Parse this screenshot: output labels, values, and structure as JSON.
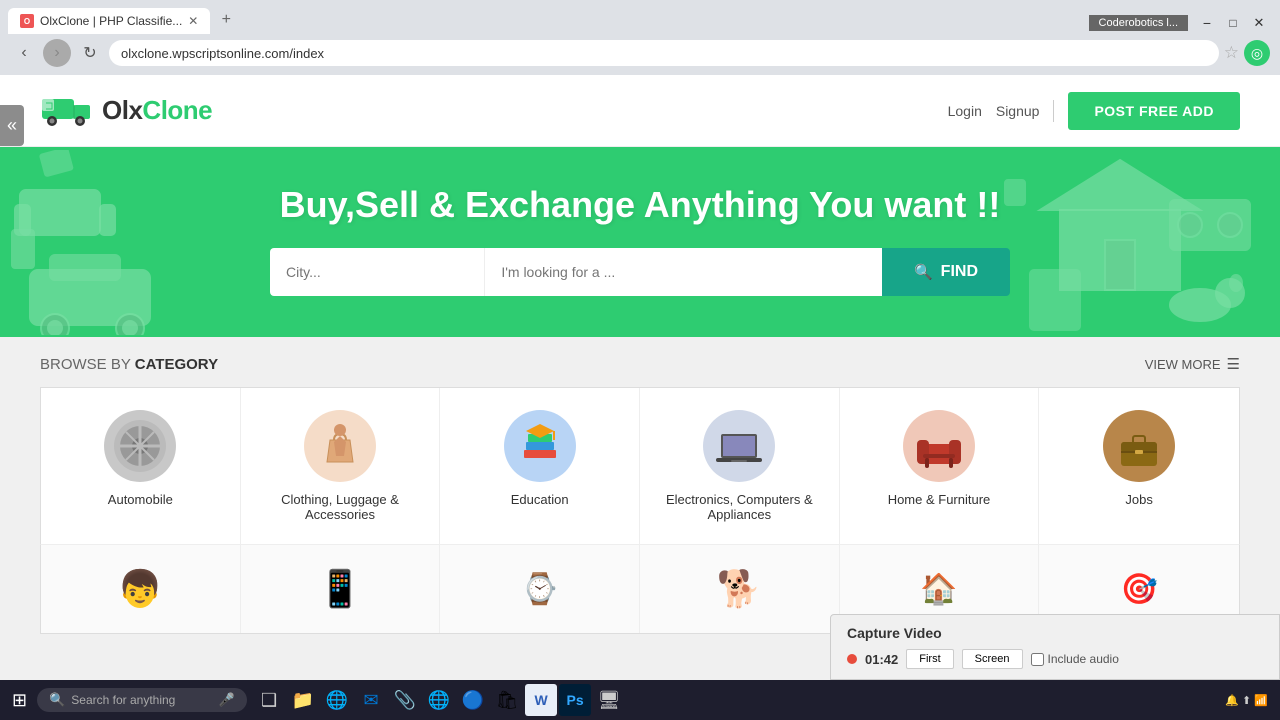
{
  "browser": {
    "tab_title": "OlxClone | PHP Classifie...",
    "tab_favicon": "O",
    "url": "olxclone.wpscriptsonline.com/index",
    "coderobotics_label": "Coderobotics l...",
    "window_controls": [
      "minimize",
      "maximize",
      "close"
    ]
  },
  "header": {
    "logo_text1": "Olx",
    "logo_text2": "Clone",
    "nav_login": "Login",
    "nav_signup": "Signup",
    "post_free_btn": "POST FREE ADD"
  },
  "hero": {
    "title": "Buy,Sell & Exchange Anything You want !!",
    "city_placeholder": "City...",
    "search_placeholder": "I'm looking for a ...",
    "find_btn": "FIND"
  },
  "categories": {
    "section_title_prefix": "BROWSE BY ",
    "section_title_bold": "CATEGORY",
    "view_more_label": "VIEW MORE",
    "items": [
      {
        "id": "automobile",
        "label": "Automobile",
        "icon_color": "#c8c8c8",
        "icon_symbol": "⚙"
      },
      {
        "id": "clothing",
        "label": "Clothing, Luggage &\nAccessories",
        "icon_color": "#f5dcc8",
        "icon_symbol": "👗"
      },
      {
        "id": "education",
        "label": "Education",
        "icon_color": "#b8d4f5",
        "icon_symbol": "📚"
      },
      {
        "id": "electronics",
        "label": "Electronics, Computers &\nAppliances",
        "icon_color": "#d8d8d8",
        "icon_symbol": "💻"
      },
      {
        "id": "home-furniture",
        "label": "Home & Furniture",
        "icon_color": "#f5c8b8",
        "icon_symbol": "🛋"
      },
      {
        "id": "jobs",
        "label": "Jobs",
        "icon_color": "#b8904a",
        "icon_symbol": "💼"
      }
    ],
    "items_row2": [
      {
        "id": "kids",
        "label": "",
        "icon_color": "#f0f0f0",
        "icon_symbol": "👶"
      },
      {
        "id": "mobiles",
        "label": "",
        "icon_color": "#222",
        "icon_symbol": "📱"
      },
      {
        "id": "fashion",
        "label": "",
        "icon_color": "#c8a040",
        "icon_symbol": "👜"
      },
      {
        "id": "pets",
        "label": "",
        "icon_color": "#333",
        "icon_symbol": "🐕"
      },
      {
        "id": "property",
        "label": "",
        "icon_color": "#a0b0c0",
        "icon_symbol": "🏠"
      },
      {
        "id": "sports",
        "label": "",
        "icon_color": "#d04020",
        "icon_symbol": "🎯"
      }
    ]
  },
  "capture_video": {
    "title": "Capture Video",
    "timer": "01:42",
    "btn_first": "First",
    "btn_screen": "Screen",
    "include_audio_label": "Include audio"
  },
  "taskbar": {
    "search_placeholder": "Search for anything",
    "icons": [
      "⊞",
      "🔍",
      "❑",
      "📁",
      "🌐",
      "✉",
      "📎",
      "🎵",
      "⊞",
      "W",
      "P",
      "🖥"
    ],
    "time": "",
    "mic_icon": "🎤"
  }
}
